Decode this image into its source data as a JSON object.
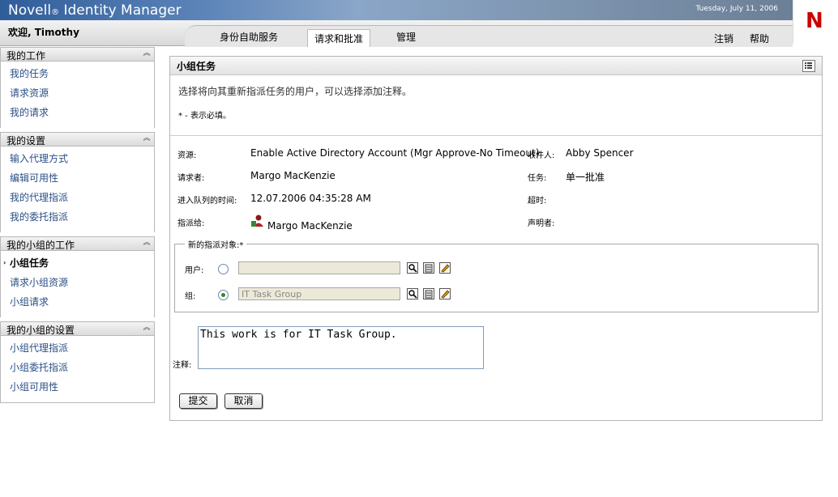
{
  "header": {
    "brand": "Novell",
    "brand_reg": "®",
    "product": "Identity Manager",
    "date": "Tuesday, July 11, 2006",
    "logo": "N",
    "welcome": "欢迎, Timothy",
    "tabs": [
      {
        "label": "身份自助服务",
        "active": false
      },
      {
        "label": "请求和批准",
        "active": true
      },
      {
        "label": "管理",
        "active": false
      }
    ],
    "links": {
      "logout": "注销",
      "help": "帮助"
    }
  },
  "sidebar": {
    "sections": [
      {
        "title": "我的工作",
        "items": [
          "我的任务",
          "请求资源",
          "我的请求"
        ]
      },
      {
        "title": "我的设置",
        "items": [
          "输入代理方式",
          "编辑可用性",
          "我的代理指派",
          "我的委托指派"
        ]
      },
      {
        "title": "我的小组的工作",
        "items": [
          "小组任务",
          "请求小组资源",
          "小组请求"
        ],
        "current": "小组任务"
      },
      {
        "title": "我的小组的设置",
        "items": [
          "小组代理指派",
          "小组委托指派",
          "小组可用性"
        ]
      }
    ]
  },
  "panel": {
    "title": "小组任务",
    "intro": "选择将向其重新指派任务的用户，可以选择添加注释。",
    "required_note": "* - 表示必填。",
    "details": {
      "resource_label": "资源:",
      "resource_value": "Enable Active Directory Account (Mgr Approve-No Timeout)",
      "recipient_label": "收件人:",
      "recipient_value": "Abby Spencer",
      "requester_label": "请求者:",
      "requester_value": "Margo MacKenzie",
      "task_label": "任务:",
      "task_value": "单一批准",
      "queued_label": "进入队列的时间:",
      "queued_value": "12.07.2006 04:35:28 AM",
      "timeout_label": "超时:",
      "assigned_label": "指派给:",
      "assigned_value": "Margo MacKenzie",
      "claimant_label": "声明者:"
    },
    "reassign": {
      "legend": "新的指派对象:*",
      "user_label": "用户:",
      "user_value": "",
      "group_label": "组:",
      "group_value": "IT Task Group",
      "selected": "group"
    },
    "comment_label": "注释:",
    "comment_value": "This work is for IT Task Group.",
    "submit_label": "提交",
    "cancel_label": "取消"
  }
}
